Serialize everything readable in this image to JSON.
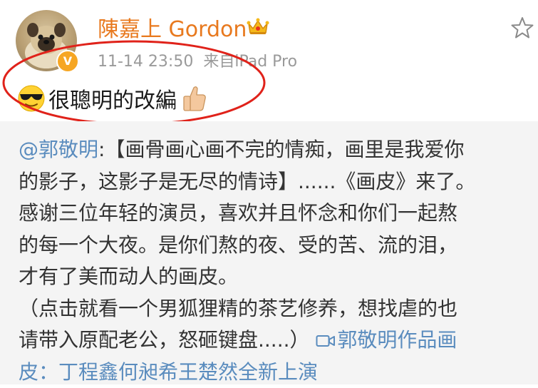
{
  "post": {
    "username": "陳嘉上 Gordon",
    "time": "11-14 23:50",
    "source": "来自iPad Pro",
    "text": "很聰明的改編",
    "verified_badge": "V",
    "icons": {
      "avatar": "avatar-pug-dog",
      "badge": "verified-badge-icon",
      "crown": "crown-icon",
      "star": "star-icon",
      "emoji_left": "sunglasses-emoji",
      "emoji_right": "thumbs-up-emoji"
    },
    "colors": {
      "username": "#e8791e",
      "badge": "#f6a623",
      "link": "#5a8cbe",
      "annotation": "#e0221a"
    }
  },
  "repost": {
    "author_mention": "@郭敬明",
    "sep": ":",
    "body_line1": "【画骨画心画不完的情痴，画里是我爱你",
    "body_line2": "的影子，这影子是无尽的情诗】......《画皮》来了。",
    "body_line3": "感谢三位年轻的演员，喜欢并且怀念和你们一起熬",
    "body_line4": "的每一个大夜。是你们熬的夜、受的苦、流的泪，",
    "body_line5": "才有了美而动人的画皮。",
    "body_line6": "（点击就看一个男狐狸精的茶艺修养，想找虐的也",
    "body_line7": "请带入原配老公，怒砸键盘.....）",
    "video_link_line1": "郭敬明作品画",
    "video_link_line2": "皮：丁程鑫何昶希王楚然全新上演"
  }
}
